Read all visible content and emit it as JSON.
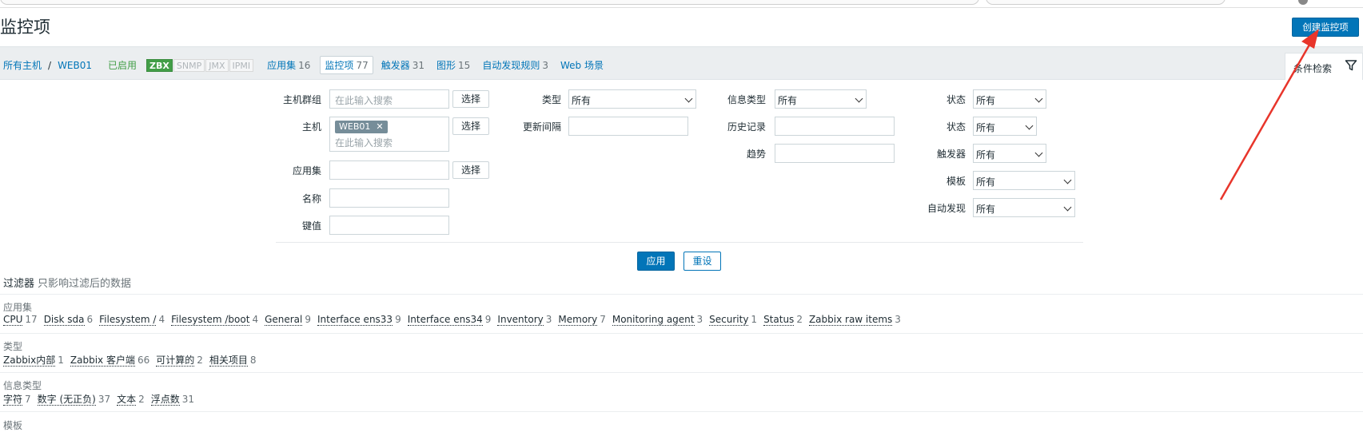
{
  "page_title": "监控项",
  "create_button": "创建监控项",
  "breadcrumb": {
    "all_hosts": "所有主机",
    "separator": "/",
    "host": "WEB01",
    "status": "已启用"
  },
  "protocols": [
    "ZBX",
    "SNMP",
    "JMX",
    "IPMI"
  ],
  "nav_links": [
    {
      "label": "应用集",
      "count": "16"
    },
    {
      "label": "监控项",
      "count": "77"
    },
    {
      "label": "触发器",
      "count": "31"
    },
    {
      "label": "图形",
      "count": "15"
    },
    {
      "label": "自动发现规则",
      "count": "3"
    },
    {
      "label": "Web 场景",
      "count": ""
    }
  ],
  "filter_tab": "条件检索",
  "form": {
    "host_group_label": "主机群组",
    "host_group_placeholder": "在此输入搜索",
    "select_label": "选择",
    "host_label": "主机",
    "host_tag": "WEB01",
    "host_placeholder": "在此输入搜索",
    "app_label": "应用集",
    "name_label": "名称",
    "key_label": "键值",
    "type_label": "类型",
    "type_value": "所有",
    "update_label": "更新间隔",
    "info_type_label": "信息类型",
    "info_type_value": "所有",
    "history_label": "历史记录",
    "trends_label": "趋势",
    "state_label": "状态",
    "state_value": "所有",
    "status_label": "状态",
    "status_value": "所有",
    "triggers_label": "触发器",
    "triggers_value": "所有",
    "template_label": "模板",
    "template_value": "所有",
    "discovery_label": "自动发现",
    "discovery_value": "所有",
    "apply": "应用",
    "reset": "重设"
  },
  "subfilter": {
    "title": "过滤器",
    "hint": "只影响过滤后的数据",
    "sections": [
      {
        "title": "应用集",
        "items": [
          {
            "name": "CPU",
            "count": "17"
          },
          {
            "name": "Disk sda",
            "count": "6"
          },
          {
            "name": "Filesystem /",
            "count": "4"
          },
          {
            "name": "Filesystem /boot",
            "count": "4"
          },
          {
            "name": "General",
            "count": "9"
          },
          {
            "name": "Interface ens33",
            "count": "9"
          },
          {
            "name": "Interface ens34",
            "count": "9"
          },
          {
            "name": "Inventory",
            "count": "3"
          },
          {
            "name": "Memory",
            "count": "7"
          },
          {
            "name": "Monitoring agent",
            "count": "3"
          },
          {
            "name": "Security",
            "count": "1"
          },
          {
            "name": "Status",
            "count": "2"
          },
          {
            "name": "Zabbix raw items",
            "count": "3"
          }
        ]
      },
      {
        "title": "类型",
        "items": [
          {
            "name": "Zabbix内部",
            "count": "1"
          },
          {
            "name": "Zabbix 客户端",
            "count": "66"
          },
          {
            "name": "可计算的",
            "count": "2"
          },
          {
            "name": "相关项目",
            "count": "8"
          }
        ]
      },
      {
        "title": "信息类型",
        "items": [
          {
            "name": "字符",
            "count": "7"
          },
          {
            "name": "数字 (无正负)",
            "count": "37"
          },
          {
            "name": "文本",
            "count": "2"
          },
          {
            "name": "浮点数",
            "count": "31"
          }
        ]
      },
      {
        "title": "模板",
        "items": []
      }
    ]
  },
  "colors": {
    "accent": "#0275b8",
    "enabled": "#429e47",
    "annotation_arrow": "#e8352b"
  }
}
